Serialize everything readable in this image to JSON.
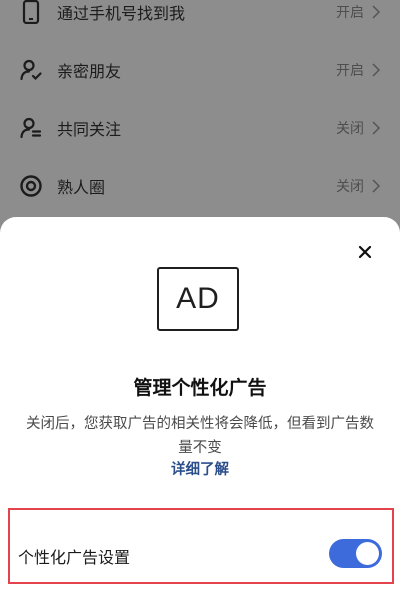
{
  "settings": {
    "rows": [
      {
        "icon": "phone-icon",
        "label": "通过手机号找到我",
        "value": "开启"
      },
      {
        "icon": "close-friend-icon",
        "label": "亲密朋友",
        "value": "开启"
      },
      {
        "icon": "mutual-follow-icon",
        "label": "共同关注",
        "value": "关闭"
      },
      {
        "icon": "circle-target-icon",
        "label": "熟人圈",
        "value": "关闭"
      }
    ]
  },
  "sheet": {
    "ad_badge": "AD",
    "title": "管理个性化广告",
    "description": "关闭后，您获取广告的相关性将会降低，但看到广告数量不变",
    "link": "详细了解",
    "setting_label": "个性化广告设置",
    "toggle_on": true
  },
  "colors": {
    "accent": "#3d6bdc",
    "link": "#2c4f8c",
    "highlight": "#e3434b",
    "overlay": "#8d8d8d"
  }
}
